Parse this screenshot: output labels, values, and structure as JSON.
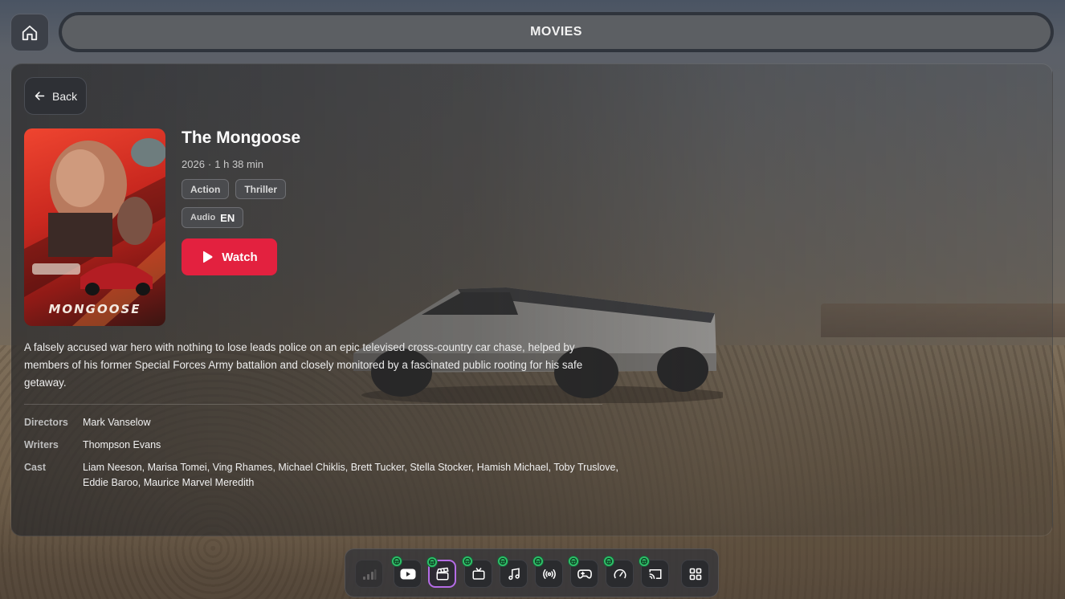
{
  "header": {
    "title": "MOVIES",
    "home_icon": "home-icon"
  },
  "detail": {
    "back_label": "Back",
    "title": "The Mongoose",
    "year": "2026",
    "separator": "·",
    "runtime": "1 h 38 min",
    "genres": [
      "Action",
      "Thriller"
    ],
    "audio_label": "Audio",
    "audio_value": "EN",
    "watch_label": "Watch",
    "poster_title": "MONGOOSE",
    "description": "A falsely accused war hero with nothing to lose leads police on an epic televised cross-country car chase, helped by members of his former Special Forces Army battalion and closely monitored by a fascinated public rooting for his safe getaway.",
    "credits": [
      {
        "label": "Directors",
        "value": "Mark Vanselow"
      },
      {
        "label": "Writers",
        "value": "Thompson Evans"
      },
      {
        "label": "Cast",
        "value": "Liam Neeson, Marisa Tomei, Ving Rhames, Michael Chiklis, Brett Tucker, Stella Stocker, Hamish Michael, Toby Truslove, Eddie Baroo, Maurice Marvel Meredith"
      }
    ]
  },
  "dock": {
    "items": [
      {
        "icon": "signal-bars-icon",
        "badge": false,
        "active": false
      },
      {
        "icon": "youtube-icon",
        "badge": true,
        "active": false
      },
      {
        "icon": "clapperboard-icon",
        "badge": true,
        "active": true
      },
      {
        "icon": "tv-icon",
        "badge": true,
        "active": false
      },
      {
        "icon": "music-note-icon",
        "badge": true,
        "active": false
      },
      {
        "icon": "broadcast-icon",
        "badge": true,
        "active": false
      },
      {
        "icon": "gamepad-icon",
        "badge": true,
        "active": false
      },
      {
        "icon": "speedometer-icon",
        "badge": true,
        "active": false
      },
      {
        "icon": "cast-icon",
        "badge": true,
        "active": false
      },
      {
        "icon": "grid-icon",
        "badge": false,
        "active": false
      }
    ],
    "badge_icon": "steering-wheel-icon",
    "accent_color": "#b56ce6",
    "badge_color": "#2fbf6a"
  },
  "colors": {
    "watch_button": "#e3213f"
  }
}
